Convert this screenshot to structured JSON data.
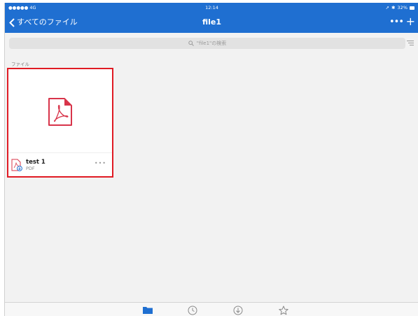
{
  "status_bar": {
    "carrier": "●●●●● 4G",
    "time": "12:14",
    "battery": "32%"
  },
  "nav": {
    "back_label": "すべてのファイル",
    "title": "file1",
    "more_label": "•••",
    "add_label": "+"
  },
  "search": {
    "placeholder": "\"file1\"の検索"
  },
  "section": {
    "label": "ファイル"
  },
  "file": {
    "name": "test 1",
    "type": "PDF",
    "more_label": "•••"
  },
  "colors": {
    "accent": "#1f6fd1",
    "pdf_red": "#d8344a",
    "highlight": "#e01b24"
  },
  "tabs": [
    {
      "icon": "folder-icon",
      "active": true
    },
    {
      "icon": "clock-icon",
      "active": false
    },
    {
      "icon": "download-icon",
      "active": false
    },
    {
      "icon": "star-icon",
      "active": false
    }
  ]
}
